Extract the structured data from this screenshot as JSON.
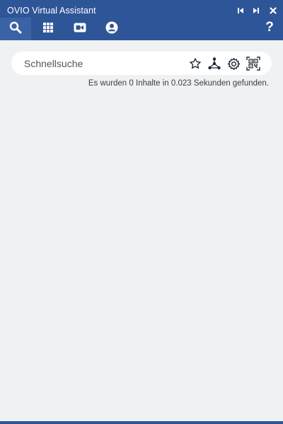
{
  "window": {
    "title": "OVIO Virtual Assistant",
    "controls": [
      "skip-back-icon",
      "skip-forward-icon",
      "close-icon"
    ]
  },
  "nav": {
    "tabs": [
      {
        "icon": "search-icon",
        "active": true
      },
      {
        "icon": "grid-icon",
        "active": false
      },
      {
        "icon": "video-camera-icon",
        "active": false
      },
      {
        "icon": "user-circle-icon",
        "active": false
      }
    ],
    "help_label": "?"
  },
  "search": {
    "placeholder": "Schnellsuche",
    "value": "",
    "tools": [
      "star-icon",
      "network-icon",
      "gear-icon",
      "qr-code-icon"
    ]
  },
  "status": {
    "text": "Es wurden 0 Inhalte in 0.023 Sekunden gefunden."
  },
  "colors": {
    "header": "#2e5597",
    "active_tab": "#3a63a5",
    "background": "#f0f1f3"
  }
}
